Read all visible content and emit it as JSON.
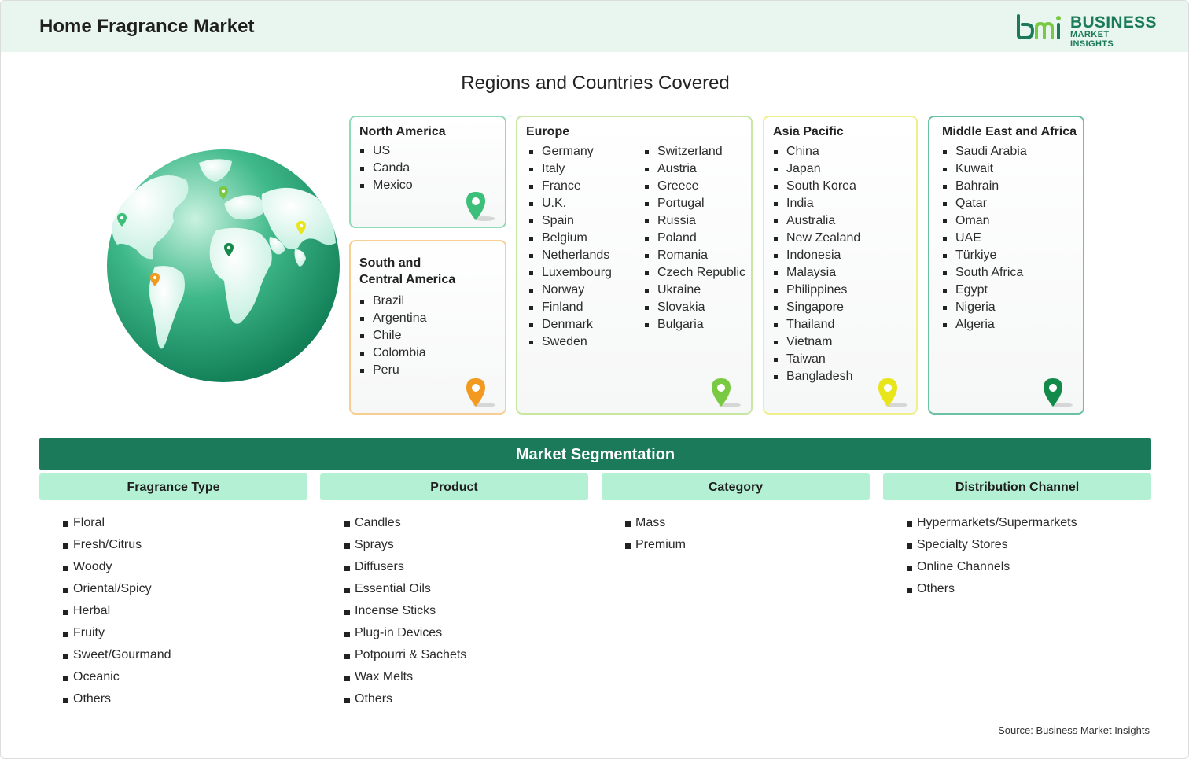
{
  "header": {
    "title": "Home Fragrance Market"
  },
  "logo": {
    "line1": "BUSINESS",
    "line2": "MARKET INSIGHTS"
  },
  "regions": {
    "title": "Regions and Countries Covered",
    "north_america": {
      "title": "North America",
      "items": [
        "US",
        "Canda",
        "Mexico"
      ],
      "pin_color": "#3cbf78"
    },
    "south_america": {
      "title_line1": "South and",
      "title_line2": "Central America",
      "items": [
        "Brazil",
        "Argentina",
        "Chile",
        "Colombia",
        "Peru"
      ],
      "pin_color": "#f29a1f"
    },
    "europe": {
      "title": "Europe",
      "col1": [
        "Germany",
        "Italy",
        "France",
        "U.K.",
        "Spain",
        "Belgium",
        "Netherlands",
        "Luxembourg",
        "Norway",
        "Finland",
        "Denmark",
        "Sweden"
      ],
      "col2": [
        "Switzerland",
        "Austria",
        "Greece",
        "Portugal",
        "Russia",
        "Poland",
        "Romania",
        "Czech Republic",
        "Ukraine",
        "Slovakia",
        "Bulgaria"
      ],
      "pin_color": "#7ac943"
    },
    "asia_pacific": {
      "title": "Asia Pacific",
      "items": [
        "China",
        "Japan",
        "South Korea",
        "India",
        "Australia",
        "New Zealand",
        "Indonesia",
        "Malaysia",
        "Philippines",
        "Singapore",
        "Thailand",
        "Vietnam",
        "Taiwan",
        "Bangladesh"
      ],
      "pin_color": "#e8e51a"
    },
    "middle_east_africa": {
      "title": "Middle East and Africa",
      "items": [
        "Saudi Arabia",
        "Kuwait",
        "Bahrain",
        "Qatar",
        "Oman",
        "UAE",
        "Türkiye",
        "South Africa",
        "Egypt",
        "Nigeria",
        "Algeria"
      ],
      "pin_color": "#148a4a"
    }
  },
  "segmentation": {
    "title": "Market Segmentation",
    "columns": [
      {
        "header": "Fragrance Type",
        "items": [
          "Floral",
          "Fresh/Citrus",
          "Woody",
          "Oriental/Spicy",
          "Herbal",
          "Fruity",
          "Sweet/Gourmand",
          "Oceanic",
          "Others"
        ]
      },
      {
        "header": "Product",
        "items": [
          "Candles",
          "Sprays",
          "Diffusers",
          "Essential Oils",
          "Incense Sticks",
          "Plug-in Devices",
          "Potpourri & Sachets",
          "Wax Melts",
          "Others"
        ]
      },
      {
        "header": "Category",
        "items": [
          "Mass",
          "Premium"
        ]
      },
      {
        "header": "Distribution Channel",
        "items": [
          "Hypermarkets/Supermarkets",
          "Specialty Stores",
          "Online Channels",
          "Others"
        ]
      }
    ]
  },
  "source": "Source: Business Market Insights",
  "colors": {
    "brand_green": "#1a7a5a",
    "header_bg": "#e9f6ef",
    "segment_header_bg": "#b4f0d4"
  },
  "icons": [
    "globe-icon",
    "location-pin-icon",
    "bmi-logo-icon"
  ]
}
